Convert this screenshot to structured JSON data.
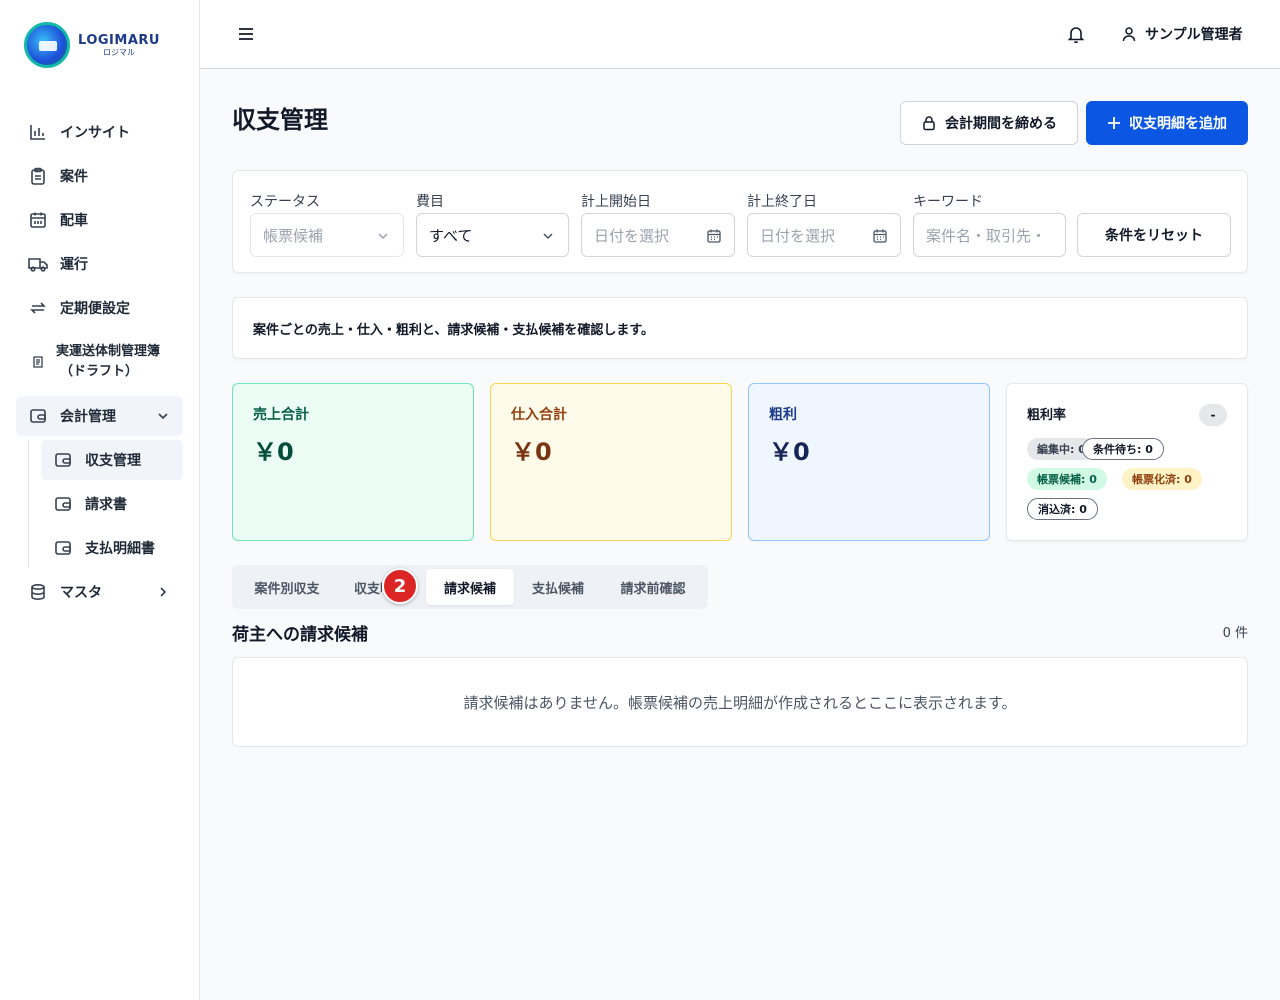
{
  "brand": {
    "name": "LOGIMARU",
    "sub": "ロジマル"
  },
  "sidebar": {
    "items": [
      {
        "label": "インサイト",
        "icon": "bar-chart-icon"
      },
      {
        "label": "案件",
        "icon": "clipboard-icon"
      },
      {
        "label": "配車",
        "icon": "calendar-icon"
      },
      {
        "label": "運行",
        "icon": "truck-icon"
      },
      {
        "label": "定期便設定",
        "icon": "repeat-icon"
      },
      {
        "label_line1": "実運送体制管理簿",
        "label_line2": "（ドラフト）",
        "icon": "scroll-icon"
      },
      {
        "label": "会計管理",
        "icon": "wallet-icon",
        "expanded": true
      },
      {
        "label": "マスタ",
        "icon": "database-icon"
      }
    ],
    "accounting_sub": [
      {
        "label": "収支管理",
        "active": true
      },
      {
        "label": "請求書"
      },
      {
        "label": "支払明細書"
      }
    ]
  },
  "header": {
    "user_name": "サンプル管理者"
  },
  "page": {
    "title": "収支管理",
    "close_period_label": "会計期間を締める",
    "add_detail_label": "収支明細を追加"
  },
  "filters": {
    "status": {
      "label": "ステータス",
      "placeholder": "帳票候補"
    },
    "expense_item": {
      "label": "費目",
      "value": "すべて"
    },
    "start_date": {
      "label": "計上開始日",
      "placeholder": "日付を選択"
    },
    "end_date": {
      "label": "計上終了日",
      "placeholder": "日付を選択"
    },
    "keyword": {
      "label": "キーワード",
      "placeholder": "案件名・取引先・"
    },
    "reset_label": "条件をリセット"
  },
  "description": "案件ごとの売上・仕入・粗利と、請求候補・支払候補を確認します。",
  "stats": {
    "sales": {
      "label": "売上合計",
      "value": "￥0"
    },
    "purchase": {
      "label": "仕入合計",
      "value": "￥0"
    },
    "profit": {
      "label": "粗利",
      "value": "￥0"
    },
    "rate": {
      "label": "粗利率",
      "value": "-",
      "badges": {
        "editing": "編集中: 0",
        "waiting": "条件待ち: 0",
        "candidate": "帳票候補: 0",
        "issued": "帳票化済: 0",
        "cleared": "消込済: 0"
      }
    }
  },
  "tabs": [
    {
      "label": "案件別収支"
    },
    {
      "label": "収支明細"
    },
    {
      "label": "請求候補",
      "active": true
    },
    {
      "label": "支払候補"
    },
    {
      "label": "請求前確認"
    }
  ],
  "step_badge": "2",
  "section": {
    "title": "荷主への請求候補",
    "count": "0 件",
    "empty_message": "請求候補はありません。帳票候補の売上明細が作成されるとここに表示されます。"
  },
  "colors": {
    "primary": "#0b57e3",
    "sales_bg": "#ecfdf5",
    "purchase_bg": "#fffbeb",
    "profit_bg": "#eff6ff",
    "step_badge": "#dc2626"
  }
}
